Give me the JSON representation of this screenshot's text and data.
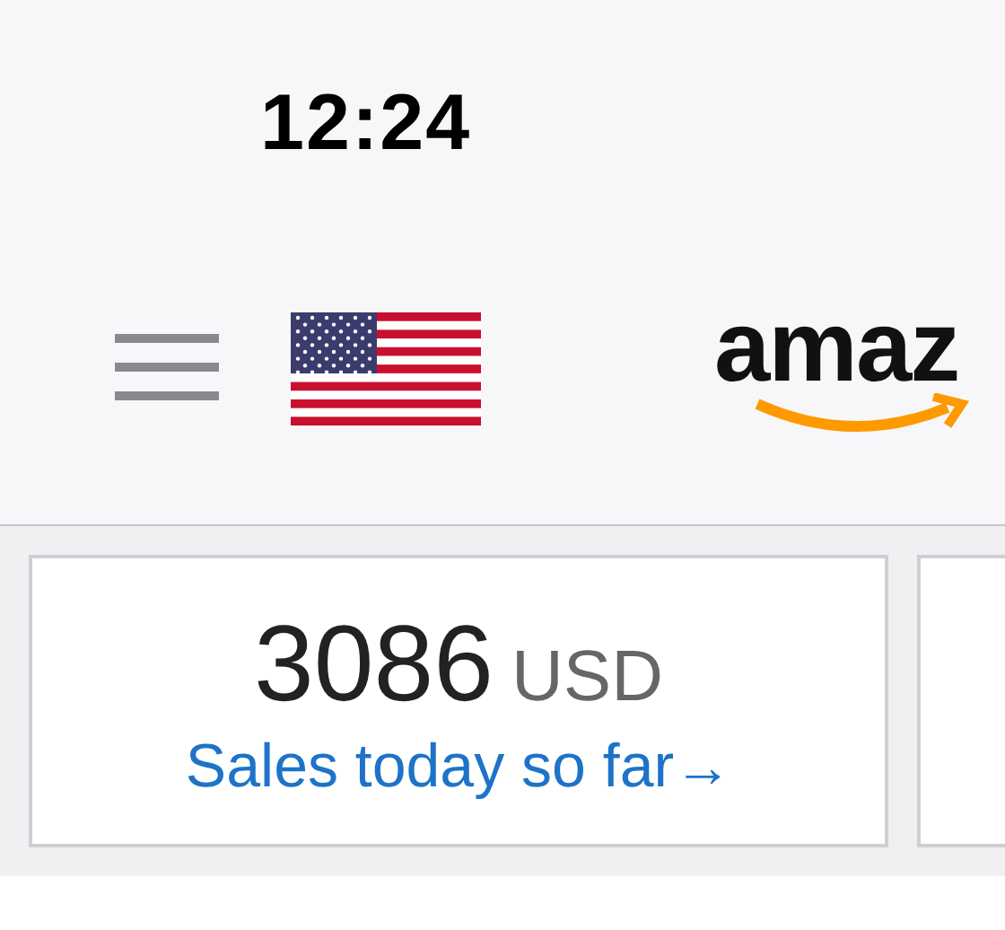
{
  "status_bar": {
    "time": "12:24"
  },
  "header": {
    "logo": "amaz"
  },
  "cards": [
    {
      "value": "3086",
      "currency": "USD",
      "link": "Sales today so far",
      "arrow": "→"
    }
  ]
}
